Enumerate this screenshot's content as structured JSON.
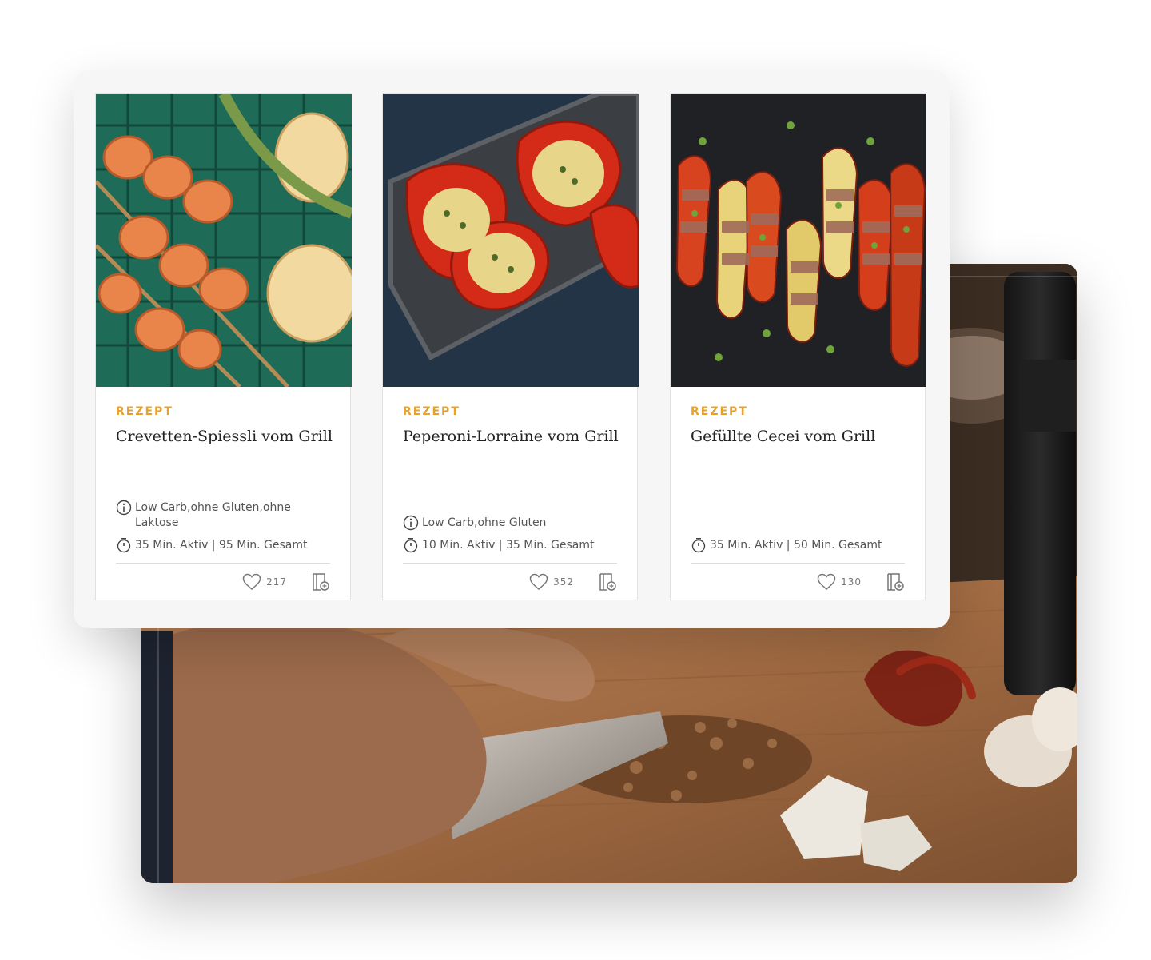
{
  "recipes": [
    {
      "category": "REZEPT",
      "title": "Crevetten-Spiessli vom Grill",
      "tags": "Low Carb,ohne Gluten,ohne Laktose",
      "time": "35 Min. Aktiv | 95 Min. Gesamt",
      "likes": "217"
    },
    {
      "category": "REZEPT",
      "title": "Peperoni-Lorraine vom Grill",
      "tags": "Low Carb,ohne Gluten",
      "time": "10 Min. Aktiv | 35 Min. Gesamt",
      "likes": "352"
    },
    {
      "category": "REZEPT",
      "title": "Gefüllte Cecei vom Grill",
      "tags": "",
      "time": "35 Min. Aktiv | 50 Min. Gesamt",
      "likes": "130"
    }
  ],
  "icons": {
    "info": "info-icon",
    "timer": "timer-icon",
    "like": "heart-icon",
    "save": "add-to-cookbook-icon"
  },
  "colors": {
    "category": "#e7a12a",
    "title": "#222222",
    "meta": "#555555",
    "panel": "#f6f6f6"
  }
}
